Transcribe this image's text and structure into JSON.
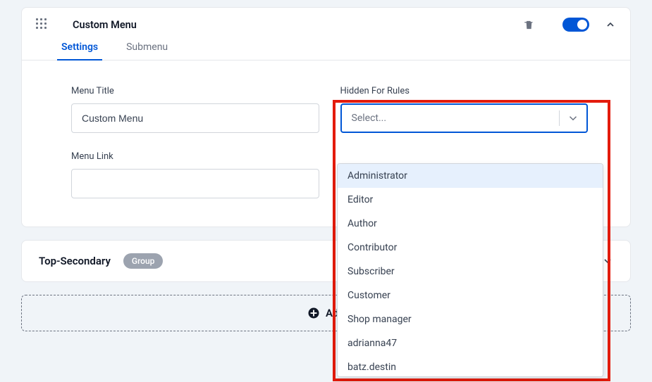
{
  "header": {
    "title": "Custom Menu"
  },
  "tabs": {
    "settings": "Settings",
    "submenu": "Submenu"
  },
  "form": {
    "menu_title_label": "Menu Title",
    "menu_title_value": "Custom Menu",
    "menu_link_label": "Menu Link",
    "menu_link_value": "",
    "hidden_label": "Hidden For Rules",
    "select_placeholder": "Select..."
  },
  "dropdown": {
    "options": [
      "Administrator",
      "Editor",
      "Author",
      "Contributor",
      "Subscriber",
      "Customer",
      "Shop manager",
      "adrianna47",
      "batz.destin"
    ]
  },
  "secondary": {
    "title": "Top-Secondary",
    "badge": "Group"
  },
  "add_button": "Add"
}
